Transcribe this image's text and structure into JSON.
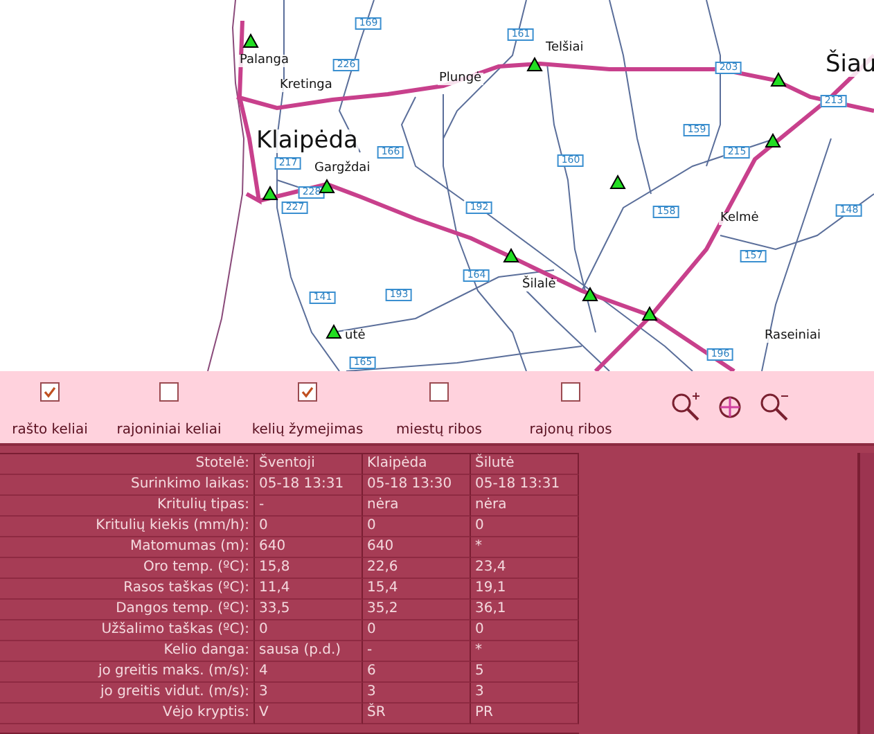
{
  "map": {
    "cities": [
      {
        "name": "Palanga",
        "kind": "town"
      },
      {
        "name": "Kretinga",
        "kind": "town"
      },
      {
        "name": "Plungė",
        "kind": "town"
      },
      {
        "name": "Telšiai",
        "kind": "town"
      },
      {
        "name": "Šiau",
        "kind": "major"
      },
      {
        "name": "Klaipėda",
        "kind": "major"
      },
      {
        "name": "Gargždai",
        "kind": "town"
      },
      {
        "name": "Kelmė",
        "kind": "town"
      },
      {
        "name": "Šilalė",
        "kind": "town"
      },
      {
        "name": "utė",
        "kind": "town"
      },
      {
        "name": "Raseiniai",
        "kind": "town"
      }
    ],
    "road_numbers": [
      "169",
      "161",
      "226",
      "203",
      "213",
      "159",
      "166",
      "217",
      "160",
      "215",
      "228",
      "227",
      "192",
      "158",
      "148",
      "157",
      "141",
      "193",
      "164",
      "165",
      "196"
    ]
  },
  "layers": [
    {
      "label": "rašto keliai",
      "checked": true
    },
    {
      "label": "rajoniniai keliai",
      "checked": false
    },
    {
      "label": "kelių žymejimas",
      "checked": true
    },
    {
      "label": "miestų ribos",
      "checked": false
    },
    {
      "label": "rajonų ribos",
      "checked": false
    }
  ],
  "table": {
    "header": {
      "label": "Stotelė:",
      "values": [
        "Šventoji",
        "Klaipėda",
        "Šilutė"
      ]
    },
    "rows": [
      {
        "label": "Surinkimo laikas:",
        "values": [
          "05-18 13:31",
          "05-18 13:30",
          "05-18 13:31"
        ]
      },
      {
        "label": "Kritulių tipas:",
        "values": [
          "-",
          "nėra",
          "nėra"
        ]
      },
      {
        "label": "Kritulių kiekis (mm/h):",
        "values": [
          "0",
          "0",
          "0"
        ]
      },
      {
        "label": "Matomumas (m):",
        "values": [
          "640",
          "640",
          "*"
        ]
      },
      {
        "label": "Oro temp. (ºC):",
        "values": [
          "15,8",
          "22,6",
          "23,4"
        ]
      },
      {
        "label": "Rasos taškas (ºC):",
        "values": [
          "11,4",
          "15,4",
          "19,1"
        ]
      },
      {
        "label": "Dangos temp. (ºC):",
        "values": [
          "33,5",
          "35,2",
          "36,1"
        ]
      },
      {
        "label": "Užšalimo taškas (ºC):",
        "values": [
          "0",
          "0",
          "0"
        ]
      },
      {
        "label": "Kelio danga:",
        "values": [
          "sausa (p.d.)",
          "-",
          "*"
        ]
      },
      {
        "label": "jo greitis maks. (m/s):",
        "values": [
          "4",
          "6",
          "5"
        ]
      },
      {
        "label": "jo greitis vidut. (m/s):",
        "values": [
          "3",
          "3",
          "3"
        ]
      },
      {
        "label": "Vėjo kryptis:",
        "values": [
          "V",
          "ŠR",
          "PR"
        ]
      }
    ]
  }
}
